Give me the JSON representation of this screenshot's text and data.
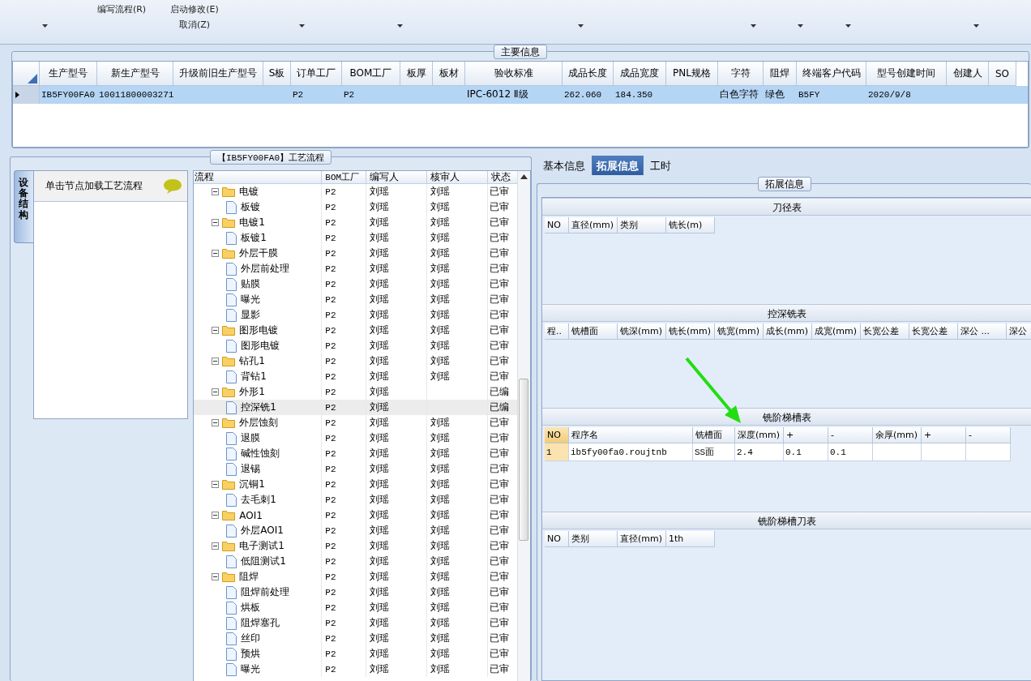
{
  "toolbar": {
    "buttons": [
      {
        "lines": [
          "编写流程(R)"
        ]
      },
      {
        "lines": [
          "启动修改(E)",
          "取消(Z)"
        ]
      }
    ]
  },
  "main_info": {
    "title": "主要信息",
    "columns": [
      "生产型号",
      "新生产型号",
      "升级前旧生产型号",
      "S板",
      "订单工厂",
      "BOM工厂",
      "板厚",
      "板材",
      "验收标准",
      "成品长度",
      "成品宽度",
      "PNL规格",
      "字符",
      "阻焊",
      "终端客户代码",
      "型号创建时间",
      "创建人",
      "SO"
    ],
    "rows": [
      {
        "selected": true,
        "cells": [
          "IB5FY00FA0",
          "10011800003271",
          "",
          "",
          "P2",
          "P2",
          "",
          "",
          "IPC-6012 Ⅱ级",
          "262.060",
          "184.350",
          "",
          "白色字符",
          "绿色",
          "B5FY",
          "2020/9/8",
          "",
          ""
        ]
      }
    ]
  },
  "process": {
    "title": "【IB5FY00FA0】工艺流程",
    "side_tab": "设备结构",
    "hint": "单击节点加载工艺流程",
    "columns": [
      "流程",
      "BOM工厂",
      "编写人",
      "核审人",
      "状态"
    ],
    "tree": [
      {
        "name": "电镀",
        "factory": "P2",
        "writer": "刘瑶",
        "reviewer": "刘瑶",
        "status": "已审",
        "selected": false,
        "expanded": true,
        "children": [
          {
            "name": "板镀",
            "factory": "P2",
            "writer": "刘瑶",
            "reviewer": "刘瑶",
            "status": "已审",
            "selected": false
          }
        ]
      },
      {
        "name": "电镀1",
        "factory": "P2",
        "writer": "刘瑶",
        "reviewer": "刘瑶",
        "status": "已审",
        "selected": false,
        "expanded": true,
        "children": [
          {
            "name": "板镀1",
            "factory": "P2",
            "writer": "刘瑶",
            "reviewer": "刘瑶",
            "status": "已审",
            "selected": false
          }
        ]
      },
      {
        "name": "外层干膜",
        "factory": "P2",
        "writer": "刘瑶",
        "reviewer": "刘瑶",
        "status": "已审",
        "selected": false,
        "expanded": true,
        "children": [
          {
            "name": "外层前处理",
            "factory": "P2",
            "writer": "刘瑶",
            "reviewer": "刘瑶",
            "status": "已审",
            "selected": false
          },
          {
            "name": "贴膜",
            "factory": "P2",
            "writer": "刘瑶",
            "reviewer": "刘瑶",
            "status": "已审",
            "selected": false
          },
          {
            "name": "曝光",
            "factory": "P2",
            "writer": "刘瑶",
            "reviewer": "刘瑶",
            "status": "已审",
            "selected": false
          },
          {
            "name": "显影",
            "factory": "P2",
            "writer": "刘瑶",
            "reviewer": "刘瑶",
            "status": "已审",
            "selected": false
          }
        ]
      },
      {
        "name": "图形电镀",
        "factory": "P2",
        "writer": "刘瑶",
        "reviewer": "刘瑶",
        "status": "已审",
        "selected": false,
        "expanded": true,
        "children": [
          {
            "name": "图形电镀",
            "factory": "P2",
            "writer": "刘瑶",
            "reviewer": "刘瑶",
            "status": "已审",
            "selected": false
          }
        ]
      },
      {
        "name": "钻孔1",
        "factory": "P2",
        "writer": "刘瑶",
        "reviewer": "刘瑶",
        "status": "已审",
        "selected": false,
        "expanded": true,
        "children": [
          {
            "name": "背钻1",
            "factory": "P2",
            "writer": "刘瑶",
            "reviewer": "刘瑶",
            "status": "已审",
            "selected": false
          }
        ]
      },
      {
        "name": "外形1",
        "factory": "P2",
        "writer": "刘瑶",
        "status": "已编",
        "selected": false,
        "expanded": true,
        "children": [
          {
            "name": "控深铣1",
            "factory": "P2",
            "writer": "刘瑶",
            "status": "已编",
            "selected": true
          }
        ]
      },
      {
        "name": "外层蚀刻",
        "factory": "P2",
        "writer": "刘瑶",
        "reviewer": "刘瑶",
        "status": "已审",
        "selected": false,
        "expanded": true,
        "children": [
          {
            "name": "退膜",
            "factory": "P2",
            "writer": "刘瑶",
            "reviewer": "刘瑶",
            "status": "已审",
            "selected": false
          },
          {
            "name": "碱性蚀刻",
            "factory": "P2",
            "writer": "刘瑶",
            "reviewer": "刘瑶",
            "status": "已审",
            "selected": false
          },
          {
            "name": "退锡",
            "factory": "P2",
            "writer": "刘瑶",
            "reviewer": "刘瑶",
            "status": "已审",
            "selected": false
          }
        ]
      },
      {
        "name": "沉铜1",
        "factory": "P2",
        "writer": "刘瑶",
        "reviewer": "刘瑶",
        "status": "已审",
        "selected": false,
        "expanded": true,
        "children": [
          {
            "name": "去毛刺1",
            "factory": "P2",
            "writer": "刘瑶",
            "reviewer": "刘瑶",
            "status": "已审",
            "selected": false
          }
        ]
      },
      {
        "name": "AOI1",
        "factory": "P2",
        "writer": "刘瑶",
        "reviewer": "刘瑶",
        "status": "已审",
        "selected": false,
        "expanded": true,
        "children": [
          {
            "name": "外层AOI1",
            "factory": "P2",
            "writer": "刘瑶",
            "reviewer": "刘瑶",
            "status": "已审",
            "selected": false
          }
        ]
      },
      {
        "name": "电子测试1",
        "factory": "P2",
        "writer": "刘瑶",
        "reviewer": "刘瑶",
        "status": "已审",
        "selected": false,
        "expanded": true,
        "children": [
          {
            "name": "低阻测试1",
            "factory": "P2",
            "writer": "刘瑶",
            "reviewer": "刘瑶",
            "status": "已审",
            "selected": false
          }
        ]
      },
      {
        "name": "阻焊",
        "factory": "P2",
        "writer": "刘瑶",
        "reviewer": "刘瑶",
        "status": "已审",
        "selected": false,
        "expanded": true,
        "children": [
          {
            "name": "阻焊前处理",
            "factory": "P2",
            "writer": "刘瑶",
            "reviewer": "刘瑶",
            "status": "已审",
            "selected": false
          },
          {
            "name": "烘板",
            "factory": "P2",
            "writer": "刘瑶",
            "reviewer": "刘瑶",
            "status": "已审",
            "selected": false
          },
          {
            "name": "阻焊塞孔",
            "factory": "P2",
            "writer": "刘瑶",
            "reviewer": "刘瑶",
            "status": "已审",
            "selected": false
          },
          {
            "name": "丝印",
            "factory": "P2",
            "writer": "刘瑶",
            "reviewer": "刘瑶",
            "status": "已审",
            "selected": false
          },
          {
            "name": "预烘",
            "factory": "P2",
            "writer": "刘瑶",
            "reviewer": "刘瑶",
            "status": "已审",
            "selected": false
          },
          {
            "name": "曝光",
            "factory": "P2",
            "writer": "刘瑶",
            "reviewer": "刘瑶",
            "status": "已审",
            "selected": false
          }
        ]
      }
    ]
  },
  "detail": {
    "tabs": [
      {
        "label": "基本信息",
        "selected": false
      },
      {
        "label": "拓展信息",
        "selected": true
      },
      {
        "label": "工时",
        "selected": false
      }
    ],
    "group_title": "拓展信息",
    "tables": [
      {
        "title": "刀径表",
        "columns": [
          "NO",
          "直径(mm)",
          "类别",
          "铣长(m)"
        ]
      },
      {
        "title": "控深铣表",
        "columns": [
          "程..",
          "铣槽面",
          "铣深(mm)",
          "铣长(mm)",
          "铣宽(mm)",
          "成长(mm)",
          "成宽(mm)",
          "长宽公差",
          "长宽公差",
          "深公 ...",
          "深公"
        ]
      },
      {
        "title": "铣阶梯槽表",
        "columns": [
          "NO",
          "程序名",
          "铣槽面",
          "深度(mm)",
          "+",
          "-",
          "余厚(mm)",
          "+",
          "-"
        ],
        "rows": [
          [
            "1",
            "ib5fy00fa0.roujtnb",
            "SS面",
            "2.4",
            "0.1",
            "0.1",
            "",
            "",
            ""
          ]
        ]
      },
      {
        "title": "铣阶梯槽刀表",
        "columns": [
          "NO",
          "类别",
          "直径(mm)",
          "1th"
        ]
      }
    ]
  }
}
